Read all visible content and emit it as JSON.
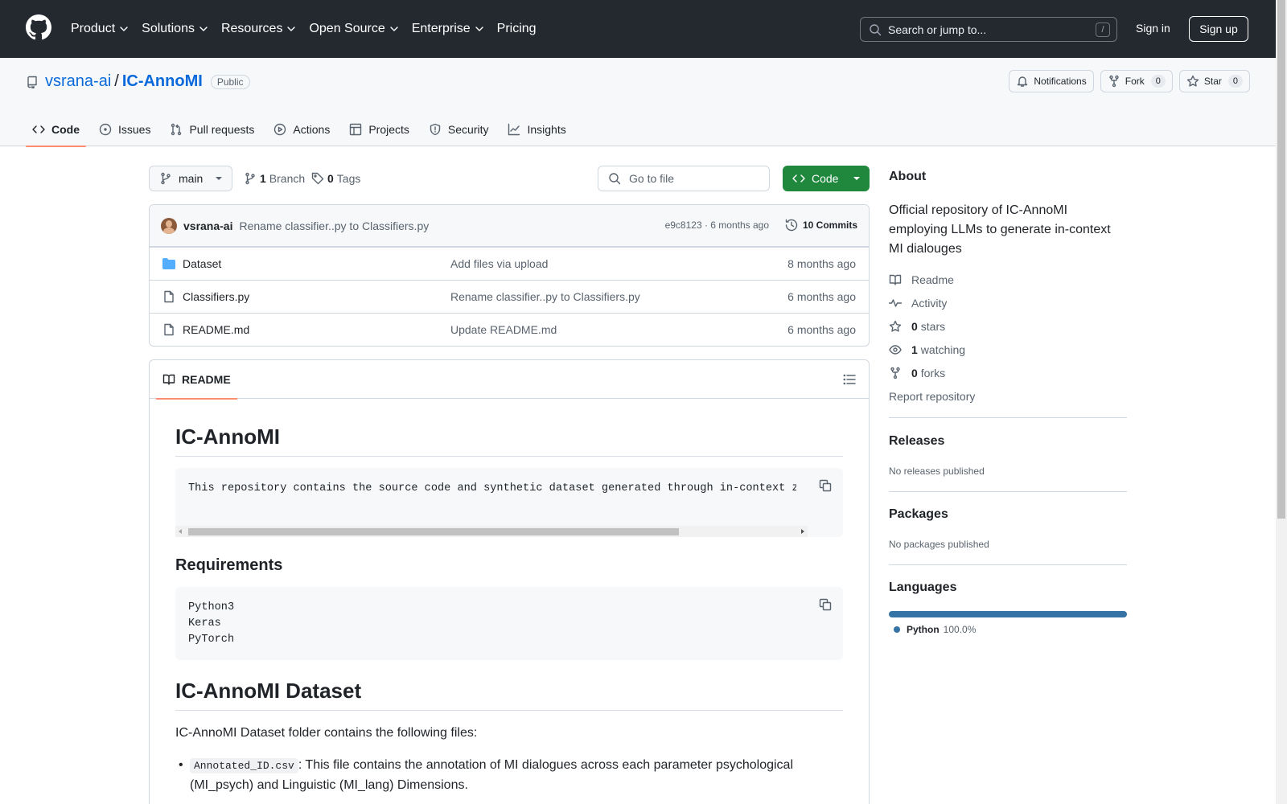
{
  "header": {
    "nav": [
      "Product",
      "Solutions",
      "Resources",
      "Open Source",
      "Enterprise",
      "Pricing"
    ],
    "search_placeholder": "Search or jump to...",
    "search_shortcut": "/",
    "signin": "Sign in",
    "signup": "Sign up"
  },
  "repo": {
    "owner": "vsrana-ai",
    "separator": "/",
    "name": "IC-AnnoMI",
    "visibility": "Public",
    "notifications_label": "Notifications",
    "fork_label": "Fork",
    "fork_count": "0",
    "star_label": "Star",
    "star_count": "0"
  },
  "tabs": [
    "Code",
    "Issues",
    "Pull requests",
    "Actions",
    "Projects",
    "Security",
    "Insights"
  ],
  "toolbar": {
    "branch": "main",
    "branch_count": "1",
    "branch_label": "Branch",
    "tag_count": "0",
    "tag_label": "Tags",
    "goto_placeholder": "Go to file",
    "code_button": "Code"
  },
  "commit": {
    "author": "vsrana-ai",
    "message": "Rename classifier..py to Classifiers.py",
    "hash_time": "e9c8123 · 6 months ago",
    "commits_label": "10 Commits"
  },
  "files": [
    {
      "type": "folder",
      "name": "Dataset",
      "message": "Add files via upload",
      "date": "8 months ago"
    },
    {
      "type": "file",
      "name": "Classifiers.py",
      "message": "Rename classifier..py to Classifiers.py",
      "date": "6 months ago"
    },
    {
      "type": "file",
      "name": "README.md",
      "message": "Update README.md",
      "date": "6 months ago"
    }
  ],
  "readme": {
    "tab_label": "README",
    "h1": "IC-AnnoMI",
    "intro_code": "This repository contains the source code and synthetic dataset generated through in-context zer",
    "req_heading": "Requirements",
    "req_lines": [
      "Python3",
      "Keras",
      "PyTorch"
    ],
    "dataset_heading": "IC-AnnoMI Dataset",
    "dataset_para": "IC-AnnoMI Dataset folder contains the following files:",
    "bullet1_code": "Annotated_ID.csv",
    "bullet1_text": ": This file contains the annotation of MI dialogues across each parameter psychological",
    "bullet1_text2": "(MI_psych) and Linguistic (MI_lang) Dimensions."
  },
  "sidebar": {
    "about_heading": "About",
    "description": "Official repository of IC-AnnoMI employing LLMs to generate in-context MI dialouges",
    "readme": "Readme",
    "activity": "Activity",
    "stars_count": "0",
    "stars_label": "stars",
    "watching_count": "1",
    "watching_label": "watching",
    "forks_count": "0",
    "forks_label": "forks",
    "report": "Report repository",
    "releases_heading": "Releases",
    "releases_note": "No releases published",
    "packages_heading": "Packages",
    "packages_note": "No packages published",
    "languages_heading": "Languages",
    "language_name": "Python",
    "language_pct": "100.0%",
    "language_color": "#3572A5"
  }
}
